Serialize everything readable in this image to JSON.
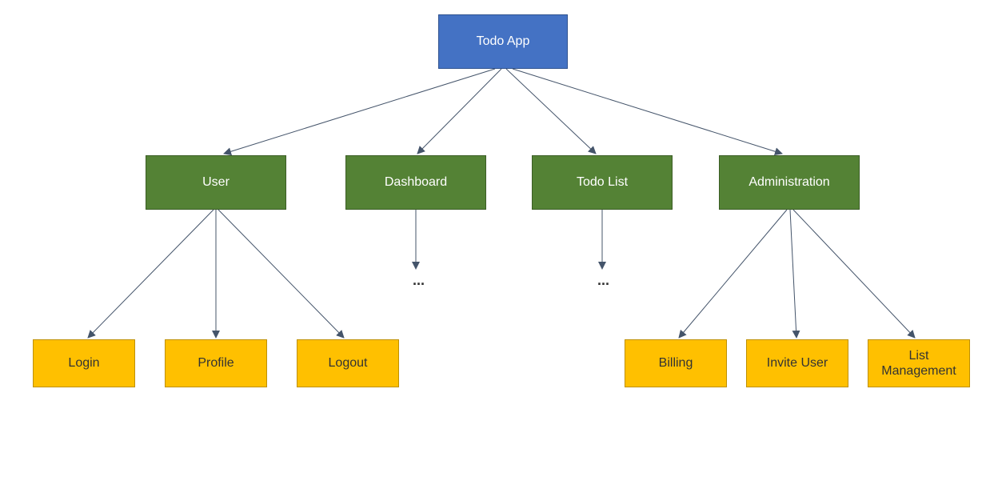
{
  "diagram": {
    "root": {
      "label": "Todo App"
    },
    "level2": {
      "user": {
        "label": "User"
      },
      "dashboard": {
        "label": "Dashboard"
      },
      "todolist": {
        "label": "Todo List"
      },
      "administration": {
        "label": "Administration"
      }
    },
    "level3": {
      "login": {
        "label": "Login"
      },
      "profile": {
        "label": "Profile"
      },
      "logout": {
        "label": "Logout"
      },
      "billing": {
        "label": "Billing"
      },
      "inviteuser": {
        "label": "Invite User"
      },
      "listmanagement": {
        "label": "List\nManagement"
      }
    },
    "ellipsis": {
      "dashboard": "...",
      "todolist": "..."
    }
  }
}
